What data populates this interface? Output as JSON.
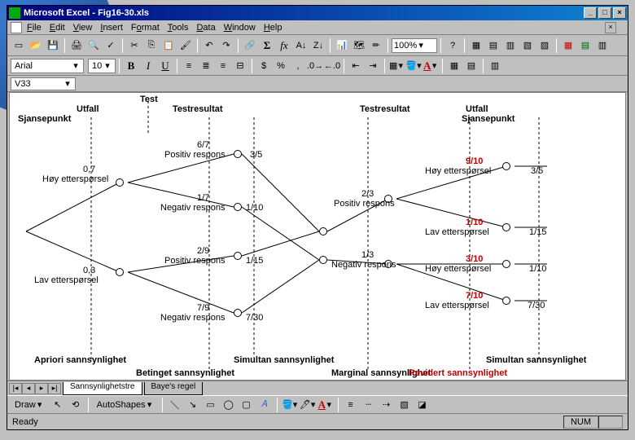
{
  "window": {
    "title": "Microsoft Excel - Fig16-30.xls"
  },
  "menu": {
    "file": "File",
    "edit": "Edit",
    "view": "View",
    "insert": "Insert",
    "format": "Format",
    "tools": "Tools",
    "data": "Data",
    "window": "Window",
    "help": "Help"
  },
  "toolbar": {
    "zoom": "100%"
  },
  "format": {
    "font": "Arial",
    "size": "10"
  },
  "cellref": "V33",
  "tree": {
    "headers": {
      "test": "Test",
      "utfall1": "Utfall",
      "sjansepunkt1": "Sjansepunkt",
      "testresultat1": "Testresultat",
      "testresultat2": "Testresultat",
      "utfall2": "Utfall",
      "sjansepunkt2": "Sjansepunkt"
    },
    "branch1": {
      "prob": "0,7",
      "label": "Høy etterspørsel"
    },
    "branch2": {
      "prob": "0,3",
      "label": "Lav etterspørsel"
    },
    "b1a": {
      "prob": "6/7",
      "label": "Positiv respons",
      "post": "3/5"
    },
    "b1b": {
      "prob": "1/7",
      "label": "Negativ respons",
      "post": "1/10"
    },
    "b2a": {
      "prob": "2/9",
      "label": "Positiv respons",
      "post": "1/15"
    },
    "b2b": {
      "prob": "7/9",
      "label": "Negativ respons",
      "post": "7/30"
    },
    "mid1": {
      "prob": "2/3",
      "label": "Positiv respons"
    },
    "mid2": {
      "prob": "1/3",
      "label": "Negativ respons"
    },
    "r1": {
      "prob": "9/10",
      "label": "Høy etterspørsel",
      "post": "3/5"
    },
    "r2": {
      "prob": "1/10",
      "label": "Lav etterspørsel",
      "post": "1/15"
    },
    "r3": {
      "prob": "3/10",
      "label": "Høy etterspørsel",
      "post": "1/10"
    },
    "r4": {
      "prob": "7/10",
      "label": "Lav etterspørsel",
      "post": "7/30"
    },
    "footers": {
      "apriori": "Apriori sannsynlighet",
      "betinget": "Betinget sannsynlighet",
      "simultan1": "Simultan sannsynlighet",
      "marginal": "Marginal sannsynlighet",
      "revidert": "Revidert sannsynlighet",
      "simultan2": "Simultan sannsynlighet"
    }
  },
  "tabs": {
    "active": "Sannsynlighetstre",
    "next": "Baye's regel"
  },
  "drawbar": {
    "draw": "Draw",
    "autoshapes": "AutoShapes"
  },
  "status": {
    "ready": "Ready",
    "num": "NUM"
  }
}
